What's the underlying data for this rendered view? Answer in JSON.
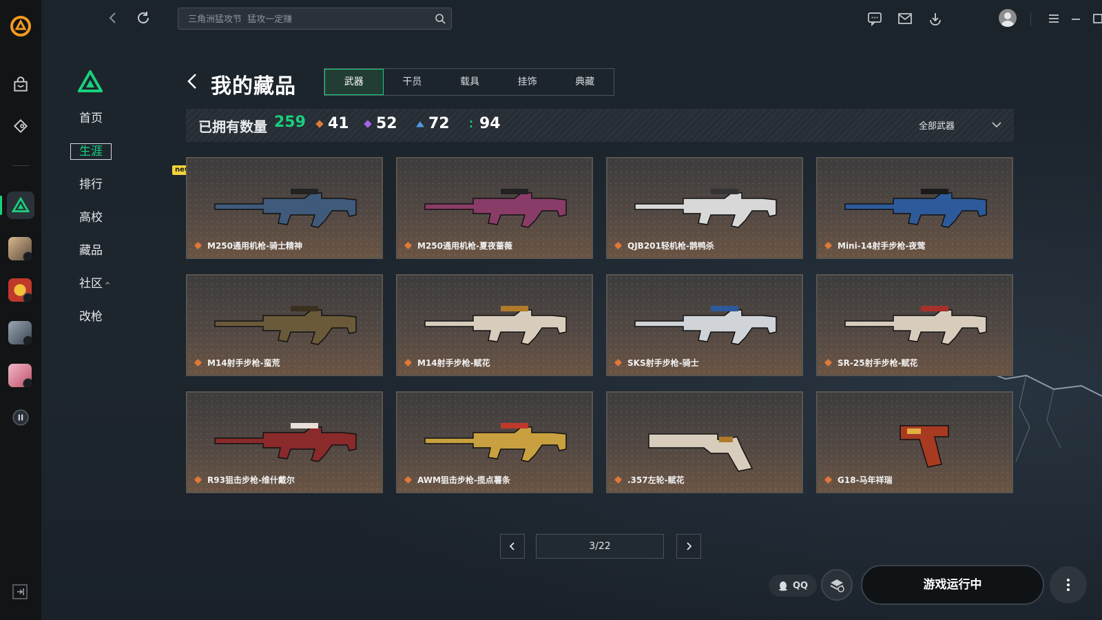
{
  "topbar": {
    "search_placeholder": "三角洲猛攻节  猛攻一定赚"
  },
  "sidebar": {
    "items": [
      {
        "label": "首页",
        "active": false
      },
      {
        "label": "生涯",
        "active": true
      },
      {
        "label": "排行",
        "active": false,
        "badge": "new"
      },
      {
        "label": "高校",
        "active": false
      },
      {
        "label": "藏品",
        "active": false
      },
      {
        "label": "社区",
        "active": false,
        "caret": "^"
      },
      {
        "label": "改枪",
        "active": false
      }
    ]
  },
  "page": {
    "title": "我的藏品",
    "tabs": [
      {
        "label": "武器",
        "active": true
      },
      {
        "label": "干员",
        "active": false
      },
      {
        "label": "载具",
        "active": false
      },
      {
        "label": "挂饰",
        "active": false
      },
      {
        "label": "典藏",
        "active": false
      }
    ]
  },
  "stats": {
    "owned_label": "已拥有数量",
    "owned_count": "259",
    "tiers": [
      {
        "value": "41",
        "color": "#e0783a"
      },
      {
        "value": "52",
        "color": "#a266e8"
      },
      {
        "value": "72",
        "color": "#4f9be8"
      },
      {
        "value": "94",
        "color": "#19d17c"
      }
    ],
    "filter_label": "全部武器"
  },
  "items": [
    {
      "name": "M250通用机枪-骑士精神",
      "gun_color": "#3f5a7a",
      "accent": "#222"
    },
    {
      "name": "M250通用机枪-夏夜蔷薇",
      "gun_color": "#8a3c68",
      "accent": "#222"
    },
    {
      "name": "QJB201轻机枪-鹊鸭杀",
      "gun_color": "#d8d8d8",
      "accent": "#333"
    },
    {
      "name": "Mini-14射手步枪-夜莺",
      "gun_color": "#2d5a9a",
      "accent": "#1a1a1a"
    },
    {
      "name": "M14射手步枪-蛮荒",
      "gun_color": "#6a5a3a",
      "accent": "#3a3020"
    },
    {
      "name": "M14射手步枪-赋花",
      "gun_color": "#d8cdbd",
      "accent": "#b07a2a"
    },
    {
      "name": "SKS射手步枪-骑士",
      "gun_color": "#d0d4d8",
      "accent": "#2d5a9a"
    },
    {
      "name": "SR-25射手步枪-赋花",
      "gun_color": "#d8cdbd",
      "accent": "#a8302a"
    },
    {
      "name": "R93狙击步枪-维什戴尔",
      "gun_color": "#8a2a2a",
      "accent": "#e8e0d8"
    },
    {
      "name": "AWM狙击步枪-揽点薯条",
      "gun_color": "#c9a040",
      "accent": "#c0392b"
    },
    {
      "name": ".357左轮-赋花",
      "gun_color": "#d8cdbd",
      "accent": "#b07a2a"
    },
    {
      "name": "G18-马年祥瑞",
      "gun_color": "#a83a22",
      "accent": "#e0b040"
    }
  ],
  "pagination": {
    "current": "3/22"
  },
  "bottom": {
    "qq_label": "QQ",
    "run_label": "游戏运行中"
  },
  "colors": {
    "accent_green": "#19d17c",
    "quality_orange": "#e0783a"
  }
}
